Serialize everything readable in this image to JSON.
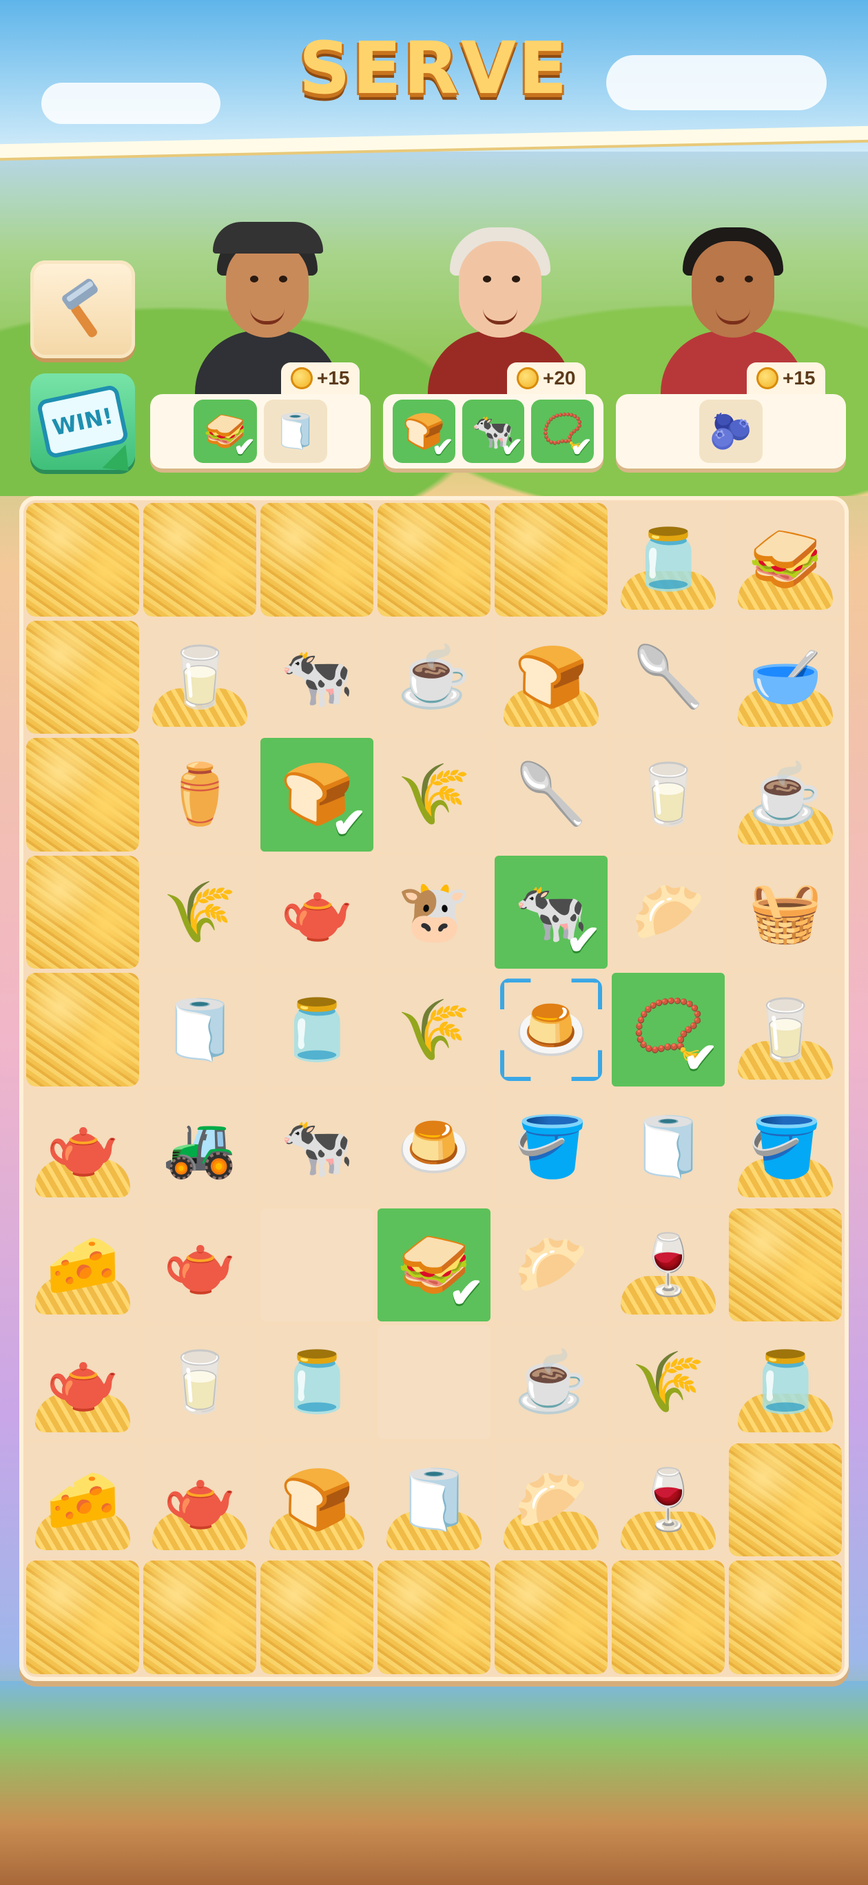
{
  "header": {
    "title": "SERVE"
  },
  "buttons": {
    "win_label": "WIN!"
  },
  "customers": [
    {
      "name": "trucker",
      "reward": "+15",
      "order": [
        {
          "icon": "sandwich",
          "glyph": "🥪",
          "done": true
        },
        {
          "icon": "napkin-roll",
          "glyph": "🧻",
          "done": false
        }
      ]
    },
    {
      "name": "granny",
      "reward": "+20",
      "order": [
        {
          "icon": "flour-bag",
          "glyph": "🍞",
          "done": true
        },
        {
          "icon": "cow",
          "glyph": "🐄",
          "done": true
        },
        {
          "icon": "photo-locket",
          "glyph": "📿",
          "done": true
        }
      ]
    },
    {
      "name": "young-man",
      "reward": "+15",
      "order": [
        {
          "icon": "berry-bowl",
          "glyph": "🫐",
          "done": false
        }
      ]
    }
  ],
  "board": {
    "rows": [
      [
        {
          "t": "hay"
        },
        {
          "t": "hay"
        },
        {
          "t": "hay"
        },
        {
          "t": "hay"
        },
        {
          "t": "hay"
        },
        {
          "t": "item",
          "icon": "jam-jar",
          "g": "🫙",
          "straw": true
        },
        {
          "t": "item",
          "icon": "sandwich",
          "g": "🥪",
          "straw": true
        }
      ],
      [
        {
          "t": "hay"
        },
        {
          "t": "item",
          "icon": "milk-carton",
          "g": "🥛",
          "straw": true
        },
        {
          "t": "item",
          "icon": "cow",
          "g": "🐄"
        },
        {
          "t": "item",
          "icon": "tea-cup",
          "g": "☕"
        },
        {
          "t": "item",
          "icon": "flour-bag",
          "g": "🍞",
          "straw": true
        },
        {
          "t": "item",
          "icon": "grain-scoop",
          "g": "🥄"
        },
        {
          "t": "item",
          "icon": "hand-mixer",
          "g": "🥣",
          "straw": true
        }
      ],
      [
        {
          "t": "hay"
        },
        {
          "t": "item",
          "icon": "coffee-grinder",
          "g": "⚱️"
        },
        {
          "t": "done",
          "icon": "flour-bag",
          "g": "🍞"
        },
        {
          "t": "item",
          "icon": "wheat",
          "g": "🌾"
        },
        {
          "t": "item",
          "icon": "grain-scoop",
          "g": "🥄"
        },
        {
          "t": "item",
          "icon": "milk-carton",
          "g": "🥛"
        },
        {
          "t": "item",
          "icon": "tea-cup",
          "g": "☕",
          "straw": true
        }
      ],
      [
        {
          "t": "hay"
        },
        {
          "t": "item",
          "icon": "wheat",
          "g": "🌾"
        },
        {
          "t": "item",
          "icon": "teapot",
          "g": "🫖"
        },
        {
          "t": "item",
          "icon": "cow-pen-generator",
          "g": "🐮"
        },
        {
          "t": "done",
          "icon": "cow",
          "g": "🐄"
        },
        {
          "t": "item",
          "icon": "dough-ball",
          "g": "🥟"
        },
        {
          "t": "item",
          "icon": "picnic-basket-generator",
          "g": "🧺"
        }
      ],
      [
        {
          "t": "hay"
        },
        {
          "t": "item",
          "icon": "napkin-roll",
          "g": "🧻"
        },
        {
          "t": "item",
          "icon": "jam-jar",
          "g": "🫙"
        },
        {
          "t": "item",
          "icon": "wheat",
          "g": "🌾"
        },
        {
          "t": "selected",
          "icon": "berry-pudding",
          "g": "🍮"
        },
        {
          "t": "done",
          "icon": "photo-locket",
          "g": "📿"
        },
        {
          "t": "item",
          "icon": "milk-carton",
          "g": "🥛",
          "straw": true
        }
      ],
      [
        {
          "t": "item",
          "icon": "teapot",
          "g": "🫖",
          "straw": true
        },
        {
          "t": "item",
          "icon": "tractor-generator",
          "g": "🚜"
        },
        {
          "t": "item",
          "icon": "cow",
          "g": "🐄"
        },
        {
          "t": "item",
          "icon": "berry-pudding",
          "g": "🍮"
        },
        {
          "t": "item",
          "icon": "wooden-bucket",
          "g": "🪣"
        },
        {
          "t": "item",
          "icon": "napkin-roll",
          "g": "🧻"
        },
        {
          "t": "item",
          "icon": "milk-bucket",
          "g": "🪣",
          "straw": true
        }
      ],
      [
        {
          "t": "item",
          "icon": "cheese",
          "g": "🧀",
          "straw": true
        },
        {
          "t": "item",
          "icon": "teapot",
          "g": "🫖"
        },
        {
          "t": "empty"
        },
        {
          "t": "done",
          "icon": "sandwich",
          "g": "🥪"
        },
        {
          "t": "item",
          "icon": "dough-ball",
          "g": "🥟"
        },
        {
          "t": "item",
          "icon": "juice-glass",
          "g": "🍷",
          "straw": true
        },
        {
          "t": "hay"
        }
      ],
      [
        {
          "t": "item",
          "icon": "teapot",
          "g": "🫖",
          "straw": true
        },
        {
          "t": "item",
          "icon": "milk-carton",
          "g": "🥛"
        },
        {
          "t": "item",
          "icon": "jam-jar",
          "g": "🫙"
        },
        {
          "t": "empty"
        },
        {
          "t": "item",
          "icon": "tea-cup",
          "g": "☕"
        },
        {
          "t": "item",
          "icon": "wheat",
          "g": "🌾"
        },
        {
          "t": "item",
          "icon": "jam-jar",
          "g": "🫙",
          "straw": true
        }
      ],
      [
        {
          "t": "item",
          "icon": "cheese",
          "g": "🧀",
          "straw": true
        },
        {
          "t": "item",
          "icon": "teapot",
          "g": "🫖",
          "straw": true
        },
        {
          "t": "item",
          "icon": "bread-loaf",
          "g": "🍞",
          "straw": true
        },
        {
          "t": "item",
          "icon": "napkin-roll",
          "g": "🧻",
          "straw": true
        },
        {
          "t": "item",
          "icon": "dough-ball",
          "g": "🥟",
          "straw": true
        },
        {
          "t": "item",
          "icon": "juice-glass",
          "g": "🍷",
          "straw": true
        },
        {
          "t": "hay"
        }
      ],
      [
        {
          "t": "hay"
        },
        {
          "t": "hay"
        },
        {
          "t": "hay"
        },
        {
          "t": "hay"
        },
        {
          "t": "hay"
        },
        {
          "t": "hay"
        },
        {
          "t": "hay"
        }
      ]
    ]
  },
  "icons": {
    "tool": "hammer-icon",
    "check": "✔"
  },
  "colors": {
    "done_tile": "#5cc15a",
    "selection": "#3aa7e6",
    "title": "#ffd36b"
  }
}
